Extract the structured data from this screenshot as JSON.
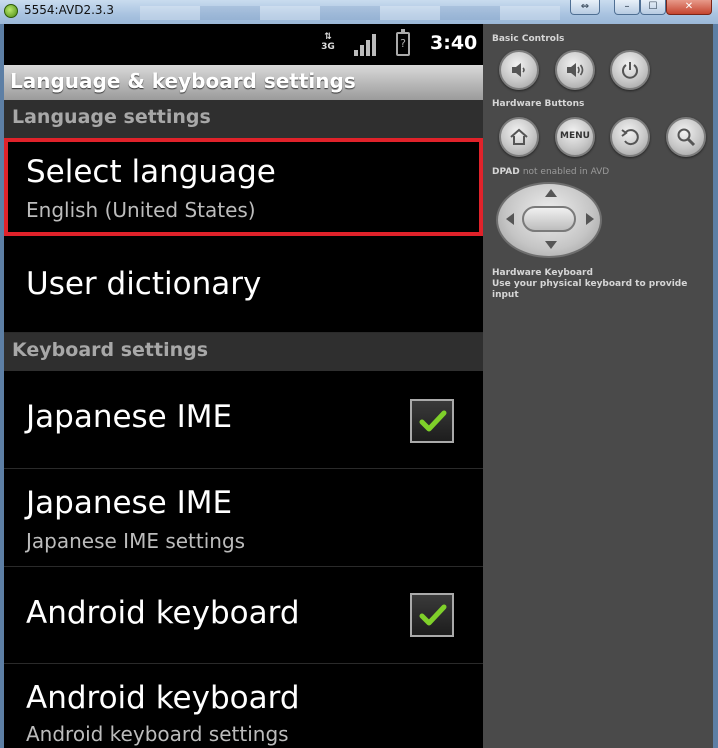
{
  "window": {
    "title": "5554:AVD2.3.3",
    "minimize": "–",
    "maximize": "☐",
    "close": "✕",
    "restore": "⇔"
  },
  "status": {
    "network": "3G",
    "time": "3:40",
    "battery_glyph": "?"
  },
  "header": {
    "title": "Language & keyboard settings"
  },
  "sections": {
    "language": "Language settings",
    "keyboard": "Keyboard settings"
  },
  "items": {
    "select_language": {
      "title": "Select language",
      "summary": "English (United States)"
    },
    "user_dictionary": {
      "title": "User dictionary"
    },
    "japanese_ime_toggle": {
      "title": "Japanese IME",
      "checked": true
    },
    "japanese_ime_settings": {
      "title": "Japanese IME",
      "summary": "Japanese IME settings"
    },
    "android_keyboard_toggle": {
      "title": "Android keyboard",
      "checked": true
    },
    "android_keyboard_settings": {
      "title": "Android keyboard",
      "summary": "Android keyboard settings"
    }
  },
  "controls": {
    "basic_label": "Basic Controls",
    "hardware_label": "Hardware Buttons",
    "menu_label": "MENU",
    "dpad_label": "DPAD",
    "dpad_note": "not enabled in AVD",
    "keyboard_label": "Hardware Keyboard",
    "keyboard_note": "Use your physical keyboard to provide input"
  },
  "colors": {
    "highlight": "#e0222a",
    "check": "#7fd02a",
    "panel": "#4a4a4a"
  },
  "icons": [
    "volume-down-icon",
    "volume-up-icon",
    "power-icon",
    "home-icon",
    "back-icon",
    "search-icon",
    "check-icon"
  ]
}
